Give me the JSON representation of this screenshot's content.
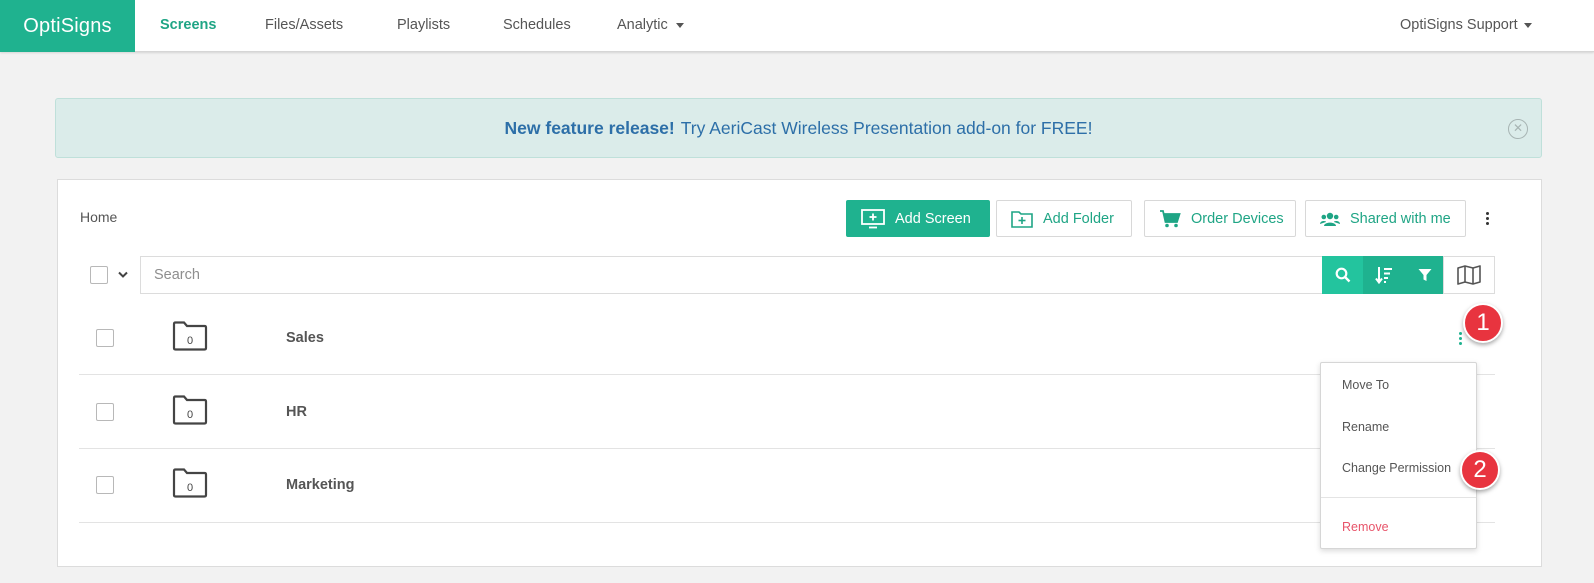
{
  "nav": {
    "brand": "OptiSigns",
    "links": [
      "Screens",
      "Files/Assets",
      "Playlists",
      "Schedules",
      "Analytic"
    ],
    "user": "OptiSigns Support"
  },
  "banner": {
    "bold": "New feature release!",
    "text": "Try AeriCast Wireless Presentation add-on for FREE!"
  },
  "toolbar": {
    "breadcrumb": "Home",
    "add_screen": "Add Screen",
    "add_folder": "Add Folder",
    "order_devices": "Order Devices",
    "shared": "Shared with me"
  },
  "search": {
    "placeholder": "Search"
  },
  "rows": [
    {
      "name": "Sales",
      "count": "0"
    },
    {
      "name": "HR",
      "count": "0"
    },
    {
      "name": "Marketing",
      "count": "0"
    }
  ],
  "menu": {
    "items": [
      "Move To",
      "Rename",
      "Change Permission"
    ],
    "danger": "Remove"
  },
  "badges": [
    "1",
    "2"
  ],
  "colors": {
    "accent": "#1fb28f",
    "banner_text": "#2d6fa8",
    "danger": "#e8546a",
    "badge": "#e8343f"
  }
}
